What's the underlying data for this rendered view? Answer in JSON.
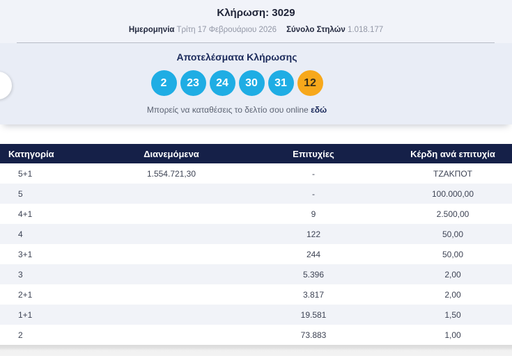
{
  "header": {
    "title": "Κλήρωση: 3029",
    "date_label": "Ημερομηνία",
    "date_value": "Τρίτη 17 Φεβρουάριου 2026",
    "columns_label": "Σύνολο Στηλών",
    "columns_value": "1.018.177"
  },
  "results": {
    "heading": "Αποτελέσματα Κλήρωσης",
    "numbers": [
      "2",
      "23",
      "24",
      "30",
      "31"
    ],
    "bonus_number": "12",
    "caption_text": "Μπορείς να καταθέσεις το δελτίο σου online",
    "caption_link_text": "εδώ"
  },
  "table": {
    "headers": [
      "Κατηγορία",
      "Διανεμόμενα",
      "Επιτυχίες",
      "Κέρδη ανά επιτυχία"
    ],
    "rows": [
      {
        "category": "5+1",
        "distributed": "1.554.721,30",
        "winners": "-",
        "prize": "ΤΖΑΚΠΟΤ"
      },
      {
        "category": "5",
        "distributed": "",
        "winners": "-",
        "prize": "100.000,00"
      },
      {
        "category": "4+1",
        "distributed": "",
        "winners": "9",
        "prize": "2.500,00"
      },
      {
        "category": "4",
        "distributed": "",
        "winners": "122",
        "prize": "50,00"
      },
      {
        "category": "3+1",
        "distributed": "",
        "winners": "244",
        "prize": "50,00"
      },
      {
        "category": "3",
        "distributed": "",
        "winners": "5.396",
        "prize": "2,00"
      },
      {
        "category": "2+1",
        "distributed": "",
        "winners": "3.817",
        "prize": "2,00"
      },
      {
        "category": "1+1",
        "distributed": "",
        "winners": "19.581",
        "prize": "1,50"
      },
      {
        "category": "2",
        "distributed": "",
        "winners": "73.883",
        "prize": "1,00"
      }
    ]
  },
  "colors": {
    "number_ball": "#1fade4",
    "bonus_ball": "#f7a81b",
    "table_header_bg": "#152048",
    "panel_bg": "#e9edf6"
  }
}
